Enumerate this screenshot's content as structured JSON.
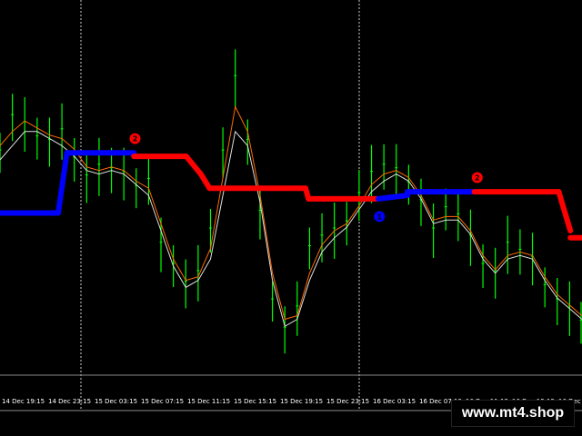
{
  "chart_data": {
    "type": "line",
    "title": "",
    "xlabel": "",
    "ylabel": "",
    "grid": false,
    "background": "#000000",
    "ylim": [
      0,
      100
    ],
    "x": [
      "14 Dec 19:15",
      "14 Dec 23:15",
      "15 Dec 03:15",
      "15 Dec 07:15",
      "15 Dec 11:15",
      "15 Dec 15:15",
      "15 Dec 19:15",
      "15 Dec 23:15",
      "16 Dec 03:15",
      "16 Dec 07:15",
      "16 Dec 11:15",
      "16 Dec 15:15",
      "16 Dec 19:15"
    ],
    "period_separators": [
      "14 Dec 23:15",
      "15 Dec 23:15"
    ],
    "series": [
      {
        "role": "price_bars",
        "color": "#00ff00",
        "values": [
          62,
          72,
          70,
          66,
          65,
          68,
          60,
          55,
          58,
          57,
          56,
          52,
          54,
          36,
          30,
          25,
          28,
          40,
          62,
          83,
          65,
          45,
          20,
          12,
          18,
          35,
          38,
          40,
          42,
          50,
          56,
          58,
          57,
          53,
          48,
          40,
          46,
          44,
          38,
          30,
          28,
          36,
          34,
          32,
          24,
          20,
          18,
          14
        ]
      },
      {
        "role": "moving_average_orange",
        "color": "#ff6a00",
        "values": [
          64,
          68,
          71,
          69,
          67,
          66,
          63,
          58,
          57,
          58,
          57,
          54,
          52,
          42,
          32,
          26,
          27,
          35,
          55,
          75,
          68,
          50,
          28,
          15,
          16,
          28,
          36,
          40,
          42,
          47,
          53,
          56,
          57,
          55,
          50,
          43,
          44,
          44,
          40,
          33,
          29,
          33,
          34,
          33,
          27,
          22,
          19,
          16
        ]
      },
      {
        "role": "moving_average_white",
        "color": "#e0e0e0",
        "values": [
          60,
          64,
          68,
          68,
          66,
          64,
          61,
          57,
          56,
          57,
          56,
          53,
          50,
          40,
          30,
          24,
          26,
          32,
          50,
          68,
          64,
          48,
          26,
          13,
          15,
          26,
          34,
          38,
          41,
          46,
          51,
          54,
          56,
          54,
          49,
          42,
          43,
          43,
          39,
          32,
          28,
          32,
          33,
          32,
          26,
          21,
          18,
          15
        ]
      },
      {
        "role": "trend_line",
        "colors": {
          "up": "#0000ff",
          "down": "#ff0000"
        },
        "segments": [
          {
            "from": 0.0,
            "to": 0.1,
            "value": 45,
            "color": "#0000ff"
          },
          {
            "from": 0.1,
            "to": 0.115,
            "value": 45,
            "to_value": 62,
            "color": "#0000ff"
          },
          {
            "from": 0.115,
            "to": 0.23,
            "value": 62,
            "color": "#0000ff"
          },
          {
            "from": 0.23,
            "to": 0.32,
            "value": 61,
            "color": "#ff0000"
          },
          {
            "from": 0.32,
            "to": 0.345,
            "value": 61,
            "to_value": 56,
            "color": "#ff0000"
          },
          {
            "from": 0.345,
            "to": 0.36,
            "value": 56,
            "to_value": 52,
            "color": "#ff0000"
          },
          {
            "from": 0.36,
            "to": 0.525,
            "value": 52,
            "color": "#ff0000"
          },
          {
            "from": 0.525,
            "to": 0.53,
            "value": 52,
            "to_value": 49,
            "color": "#ff0000"
          },
          {
            "from": 0.53,
            "to": 0.65,
            "value": 49,
            "color": "#ff0000"
          },
          {
            "from": 0.65,
            "to": 0.7,
            "value": 49,
            "to_value": 50,
            "color": "#0000ff"
          },
          {
            "from": 0.7,
            "to": 0.815,
            "value": 51,
            "color": "#0000ff"
          },
          {
            "from": 0.815,
            "to": 0.96,
            "value": 51,
            "color": "#ff0000"
          },
          {
            "from": 0.96,
            "to": 0.98,
            "value": 51,
            "to_value": 40,
            "color": "#ff0000"
          },
          {
            "from": 0.98,
            "to": 1.0,
            "value": 38,
            "color": "#ff0000"
          }
        ]
      }
    ],
    "markers": [
      {
        "label": "2",
        "at": 0.232,
        "value": 66,
        "color": "#ff0000"
      },
      {
        "label": "1",
        "at": 0.652,
        "value": 44,
        "color": "#0000ff"
      },
      {
        "label": "2",
        "at": 0.82,
        "value": 55,
        "color": "#ff0000"
      }
    ]
  },
  "watermark": "www.mt4.shop"
}
